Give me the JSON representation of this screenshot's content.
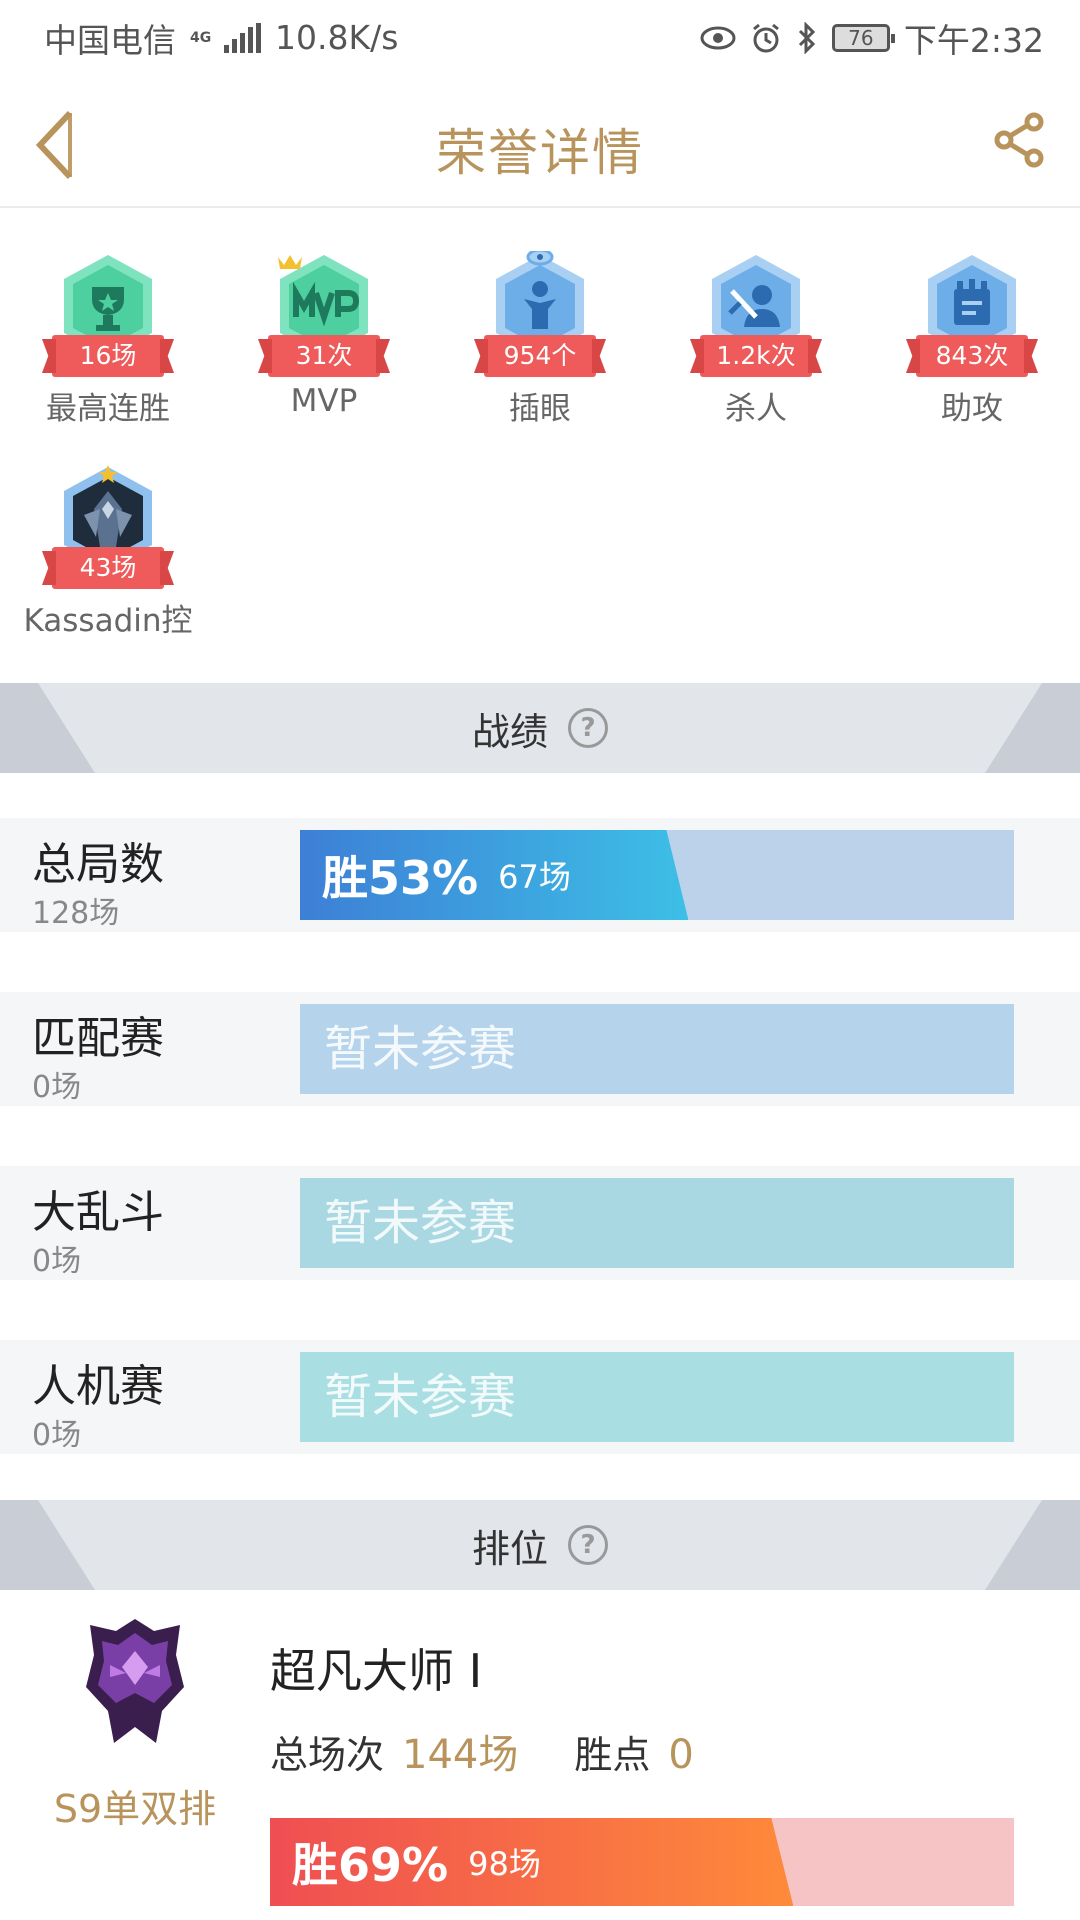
{
  "status_bar": {
    "carrier": "中国电信",
    "network": "4G",
    "speed": "10.8K/s",
    "battery": "76",
    "time": "下午2:32"
  },
  "header": {
    "title": "荣誉详情"
  },
  "honors": [
    {
      "value": "16场",
      "label": "最高连胜",
      "icon": "trophy-icon",
      "color": "#56d3a6"
    },
    {
      "value": "31次",
      "label": "MVP",
      "icon": "mvp-icon",
      "color": "#56d3a6"
    },
    {
      "value": "954个",
      "label": "插眼",
      "icon": "ward-icon",
      "color": "#6eaee8"
    },
    {
      "value": "1.2k次",
      "label": "杀人",
      "icon": "kill-icon",
      "color": "#6eaee8"
    },
    {
      "value": "843次",
      "label": "助攻",
      "icon": "assist-icon",
      "color": "#6eaee8"
    },
    {
      "value": "43场",
      "label": "Kassadin控",
      "icon": "champion-portrait-icon",
      "color": "#6eaee8"
    }
  ],
  "record_section": {
    "title": "战绩",
    "rows": [
      {
        "title": "总局数",
        "count": "128场",
        "win_label": "胜53%",
        "games_label": "67场",
        "win_rate": 0.53,
        "bar_bg": "#bcd1ea",
        "fill_from": "#3d7fd6",
        "fill_to": "#3dbfe6"
      },
      {
        "title": "匹配赛",
        "count": "0场",
        "empty_label": "暂未参赛",
        "bar_bg": "#b6d3ec"
      },
      {
        "title": "大乱斗",
        "count": "0场",
        "empty_label": "暂未参赛",
        "bar_bg": "#a9d8e3"
      },
      {
        "title": "人机赛",
        "count": "0场",
        "empty_label": "暂未参赛",
        "bar_bg": "#a9dfe2"
      }
    ]
  },
  "ranked_section": {
    "title": "排位",
    "queue": "S9单双排",
    "tier": "超凡大师 I",
    "total_label": "总场次",
    "total_value": "144场",
    "lp_label": "胜点",
    "lp_value": "0",
    "win_label": "胜69%",
    "games_label": "98场",
    "win_rate": 0.69,
    "bar_bg": "#f6c4c4",
    "fill_from": "#ef4e52",
    "fill_to": "#ff8a3a"
  }
}
